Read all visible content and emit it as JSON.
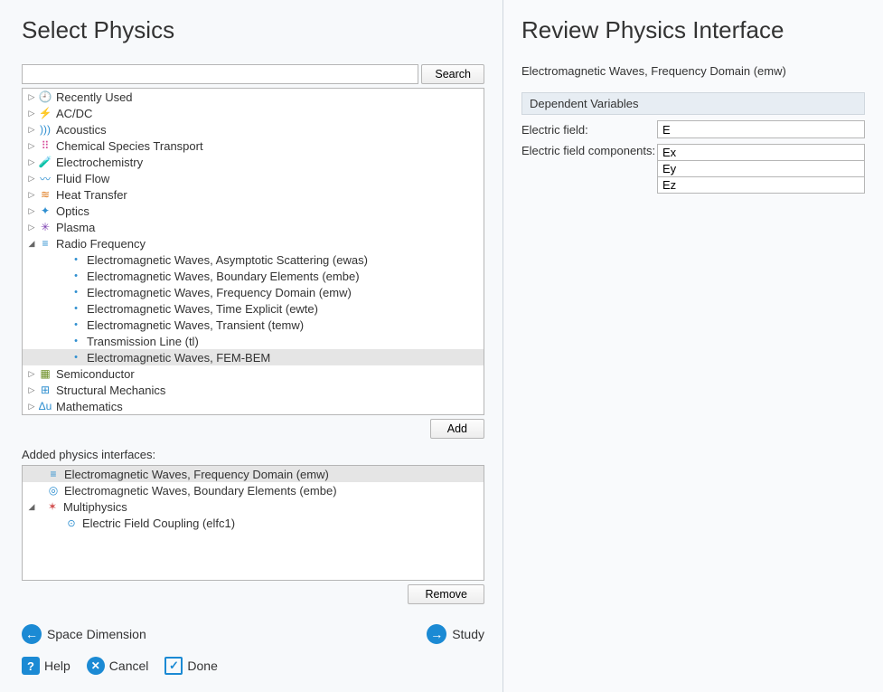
{
  "left": {
    "title": "Select Physics",
    "search_button": "Search",
    "search_value": "",
    "add_button": "Add",
    "added_label": "Added physics interfaces:",
    "remove_button": "Remove",
    "nav_back": "Space Dimension",
    "nav_forward": "Study",
    "help": "Help",
    "cancel": "Cancel",
    "done": "Done",
    "tree": [
      {
        "label": "Recently Used",
        "icon": "recent"
      },
      {
        "label": "AC/DC",
        "icon": "acdc"
      },
      {
        "label": "Acoustics",
        "icon": "acoustic"
      },
      {
        "label": "Chemical Species Transport",
        "icon": "chem"
      },
      {
        "label": "Electrochemistry",
        "icon": "electroc"
      },
      {
        "label": "Fluid Flow",
        "icon": "fluid"
      },
      {
        "label": "Heat Transfer",
        "icon": "heat"
      },
      {
        "label": "Optics",
        "icon": "optics"
      },
      {
        "label": "Plasma",
        "icon": "plasma"
      }
    ],
    "rf_label": "Radio Frequency",
    "rf_children": [
      "Electromagnetic Waves, Asymptotic Scattering (ewas)",
      "Electromagnetic Waves, Boundary Elements (embe)",
      "Electromagnetic Waves, Frequency Domain (emw)",
      "Electromagnetic Waves, Time Explicit (ewte)",
      "Electromagnetic Waves, Transient (temw)",
      "Transmission Line (tl)",
      "Electromagnetic Waves, FEM-BEM"
    ],
    "after_rf": [
      {
        "label": "Semiconductor",
        "icon": "semi"
      },
      {
        "label": "Structural Mechanics",
        "icon": "struct"
      },
      {
        "label": "Mathematics",
        "icon": "math"
      }
    ],
    "added": {
      "item0": "Electromagnetic Waves, Frequency Domain (emw)",
      "item1": "Electromagnetic Waves, Boundary Elements (embe)",
      "mp": "Multiphysics",
      "mp_child": "Electric Field Coupling (elfc1)"
    }
  },
  "right": {
    "title": "Review Physics Interface",
    "subtitle": "Electromagnetic Waves, Frequency Domain (emw)",
    "dv_header": "Dependent Variables",
    "field_label": "Electric field:",
    "field_value": "E",
    "comp_label": "Electric field components:",
    "comp0": "Ex",
    "comp1": "Ey",
    "comp2": "Ez"
  }
}
